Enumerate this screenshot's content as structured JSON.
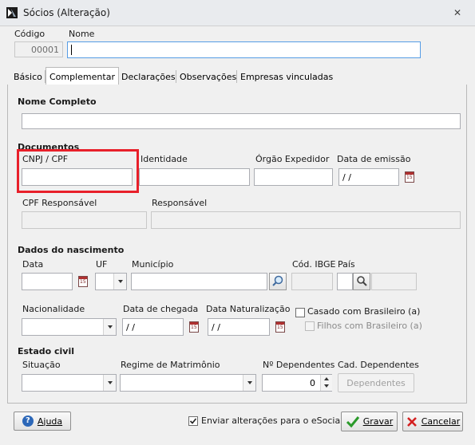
{
  "window": {
    "title": "Sócios (Alteração)",
    "close_label": "✕"
  },
  "header": {
    "codigo_label": "Código",
    "codigo_value": "00001",
    "nome_label": "Nome",
    "nome_value": ""
  },
  "tabs": [
    {
      "label": "Básico"
    },
    {
      "label": "Complementar"
    },
    {
      "label": "Declarações"
    },
    {
      "label": "Observações"
    },
    {
      "label": "Empresas vinculadas"
    }
  ],
  "complementar": {
    "nome_completo_label": "Nome Completo",
    "documentos_label": "Documentos",
    "cnpj_cpf_label": "CNPJ / CPF",
    "identidade_label": "Identidade",
    "orgao_label": "Órgão Expedidor",
    "data_emissao_label": "Data de emissão",
    "data_emissao_value": " /  /",
    "cpf_resp_label": "CPF Responsável",
    "responsavel_label": "Responsável",
    "nascimento_label": "Dados do nascimento",
    "data_label": "Data",
    "uf_label": "UF",
    "municipio_label": "Município",
    "cod_ibge_label": "Cód. IBGE",
    "pais_label": "País",
    "nacionalidade_label": "Nacionalidade",
    "data_chegada_label": "Data de chegada",
    "data_chegada_value": " /  /",
    "data_naturalizacao_label": "Data Naturalização",
    "data_naturalizacao_value": " /  /",
    "casado_label": "Casado com Brasileiro (a)",
    "filhos_label": "Filhos com Brasileiro (a)",
    "estado_civil_label": "Estado civil",
    "situacao_label": "Situação",
    "regime_label": "Regime de Matrimônio",
    "dependentes_label": "Nº Dependentes",
    "dependentes_value": "0",
    "cad_dependentes_label": "Cad. Dependentes",
    "dependentes_button": "Dependentes"
  },
  "footer": {
    "ajuda_label": "Ajuda",
    "esocial_label": "Enviar alterações para o eSocial",
    "esocial_checked": true,
    "gravar_label": "Gravar",
    "cancelar_label": "Cancelar"
  },
  "colors": {
    "highlight": "#e8202a",
    "titlebar": "#dfe3e8"
  }
}
